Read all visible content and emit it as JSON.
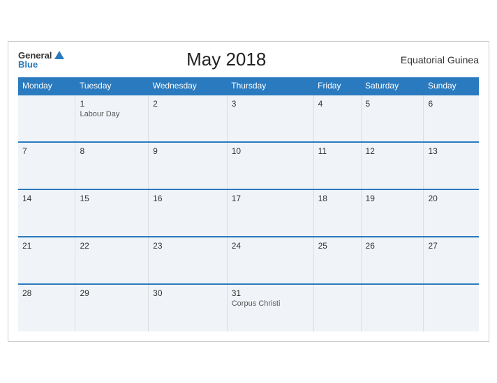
{
  "header": {
    "logo_general": "General",
    "logo_blue": "Blue",
    "title": "May 2018",
    "region": "Equatorial Guinea"
  },
  "weekdays": [
    "Monday",
    "Tuesday",
    "Wednesday",
    "Thursday",
    "Friday",
    "Saturday",
    "Sunday"
  ],
  "weeks": [
    [
      {
        "day": "",
        "holiday": ""
      },
      {
        "day": "1",
        "holiday": "Labour Day"
      },
      {
        "day": "2",
        "holiday": ""
      },
      {
        "day": "3",
        "holiday": ""
      },
      {
        "day": "4",
        "holiday": ""
      },
      {
        "day": "5",
        "holiday": ""
      },
      {
        "day": "6",
        "holiday": ""
      }
    ],
    [
      {
        "day": "7",
        "holiday": ""
      },
      {
        "day": "8",
        "holiday": ""
      },
      {
        "day": "9",
        "holiday": ""
      },
      {
        "day": "10",
        "holiday": ""
      },
      {
        "day": "11",
        "holiday": ""
      },
      {
        "day": "12",
        "holiday": ""
      },
      {
        "day": "13",
        "holiday": ""
      }
    ],
    [
      {
        "day": "14",
        "holiday": ""
      },
      {
        "day": "15",
        "holiday": ""
      },
      {
        "day": "16",
        "holiday": ""
      },
      {
        "day": "17",
        "holiday": ""
      },
      {
        "day": "18",
        "holiday": ""
      },
      {
        "day": "19",
        "holiday": ""
      },
      {
        "day": "20",
        "holiday": ""
      }
    ],
    [
      {
        "day": "21",
        "holiday": ""
      },
      {
        "day": "22",
        "holiday": ""
      },
      {
        "day": "23",
        "holiday": ""
      },
      {
        "day": "24",
        "holiday": ""
      },
      {
        "day": "25",
        "holiday": ""
      },
      {
        "day": "26",
        "holiday": ""
      },
      {
        "day": "27",
        "holiday": ""
      }
    ],
    [
      {
        "day": "28",
        "holiday": ""
      },
      {
        "day": "29",
        "holiday": ""
      },
      {
        "day": "30",
        "holiday": ""
      },
      {
        "day": "31",
        "holiday": "Corpus Christi"
      },
      {
        "day": "",
        "holiday": ""
      },
      {
        "day": "",
        "holiday": ""
      },
      {
        "day": "",
        "holiday": ""
      }
    ]
  ]
}
